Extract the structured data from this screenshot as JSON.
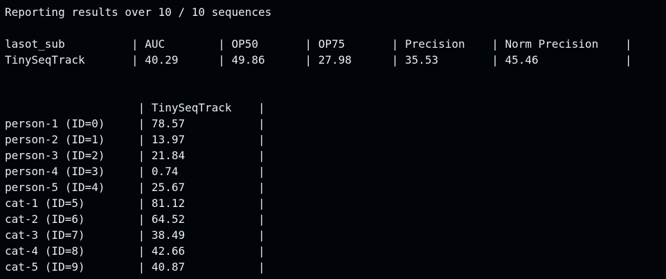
{
  "header_line": "Reporting results over 10 / 10 sequences",
  "summary_table": {
    "header_row": "lasot_sub          | AUC        | OP50       | OP75       | Precision    | Norm Precision    |",
    "rows": [
      "TinySeqTrack       | 40.29      | 49.86      | 27.98      | 35.53        | 45.46             |"
    ]
  },
  "sequence_table": {
    "header_row": "                    | TinySeqTrack    |",
    "rows": [
      "person-1 (ID=0)     | 78.57           |",
      "person-2 (ID=1)     | 13.97           |",
      "person-3 (ID=2)     | 21.84           |",
      "person-4 (ID=3)     | 0.74            |",
      "person-5 (ID=4)     | 25.67           |",
      "cat-1 (ID=5)        | 81.12           |",
      "cat-2 (ID=6)        | 64.52           |",
      "cat-3 (ID=7)        | 38.49           |",
      "cat-4 (ID=8)        | 42.66           |",
      "cat-5 (ID=9)        | 40.87           |"
    ]
  },
  "colors": {
    "background": "#010409",
    "text": "#e6edf3"
  }
}
